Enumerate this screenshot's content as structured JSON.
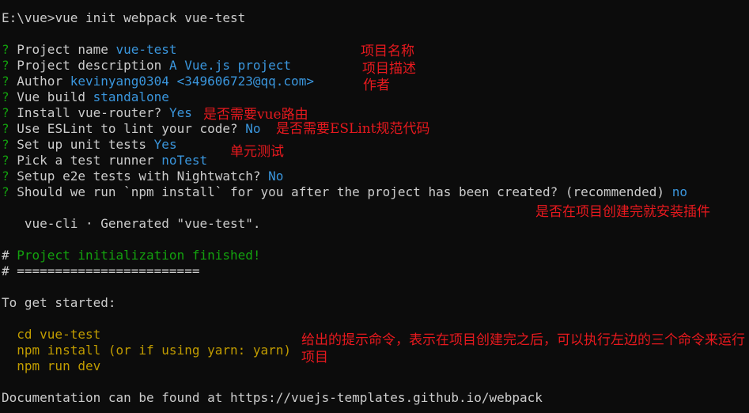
{
  "terminal": {
    "command": {
      "prompt": "E:\\vue>",
      "text": "vue init webpack vue-test"
    },
    "questions": [
      {
        "mark": "?",
        "label": " Project name ",
        "answer": "vue-test"
      },
      {
        "mark": "?",
        "label": " Project description ",
        "answer": "A Vue.js project"
      },
      {
        "mark": "?",
        "label": " Author ",
        "answer": "kevinyang0304 <349606723@qq.com>"
      },
      {
        "mark": "?",
        "label": " Vue build ",
        "answer": "standalone"
      },
      {
        "mark": "?",
        "label": " Install vue-router? ",
        "answer": "Yes"
      },
      {
        "mark": "?",
        "label": " Use ESLint to lint your code? ",
        "answer": "No"
      },
      {
        "mark": "?",
        "label": " Set up unit tests ",
        "answer": "Yes"
      },
      {
        "mark": "?",
        "label": " Pick a test runner ",
        "answer": "noTest"
      },
      {
        "mark": "?",
        "label": " Setup e2e tests with Nightwatch? ",
        "answer": "No"
      },
      {
        "mark": "?",
        "label": " Should we run `npm install` for you after the project has been created? (recommended) ",
        "answer": "no"
      }
    ],
    "generated": "   vue-cli · Generated \"vue-test\".",
    "finished_hash": "#",
    "finished_text": " Project initialization finished!",
    "separator": "# ========================",
    "get_started": "To get started:",
    "commands": [
      "  cd vue-test",
      "  npm install (or if using yarn: yarn)",
      "  npm run dev"
    ],
    "documentation": "Documentation can be found at https://vuejs-templates.github.io/webpack"
  },
  "annotations": {
    "project_name": "项目名称",
    "project_description": "项目描述",
    "author": "作者",
    "vue_router": "是否需要vue路由",
    "eslint": "是否需要ESLint规范代码",
    "unit_tests": "单元测试",
    "npm_install": "是否在项目创建完就安装插件",
    "commands": "给出的提示命令，表示在项目创建完之后，可以执行左边的三个命令来运行项目"
  },
  "colors": {
    "background": "#0c0c0c",
    "text": "#cccccc",
    "prompt_mark": "#13a10e",
    "answer": "#3a96dd",
    "success": "#13a10e",
    "command": "#c19c00",
    "annotation": "#e8191e"
  }
}
